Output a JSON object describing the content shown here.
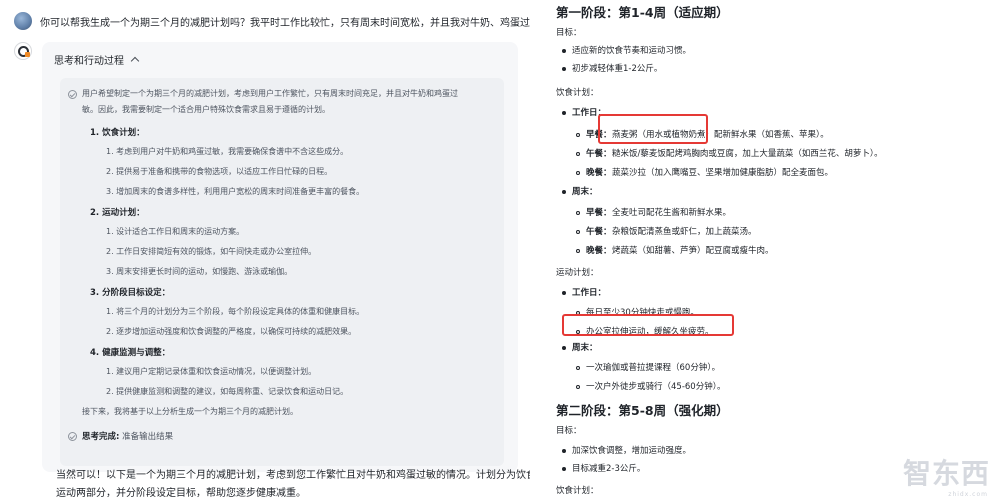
{
  "user_message": "你可以帮我生成一个为期三个月的减肥计划吗？我平时工作比较忙，只有周末时间宽松，并且我对牛奶、鸡蛋过敏。",
  "thinking": {
    "header": "思考和行动过程",
    "intro": [
      "用户希望制定一个为期三个月的减肥计划，考虑到用户工作繁忙，只有周末时间充足，并且对牛奶和鸡蛋过",
      "敏。因此，我需要制定一个适合用户特殊饮食需求且易于遵循的计划。"
    ],
    "sections": [
      {
        "title": "1.  饮食计划：",
        "items": [
          "1.  考虑到用户对牛奶和鸡蛋过敏，我需要确保食谱中不含这些成分。",
          "2.  提供易于准备和携带的食物选项，以适应工作日忙碌的日程。",
          "3.  增加周末的食谱多样性，利用用户宽松的周末时间准备更丰富的餐食。"
        ]
      },
      {
        "title": "2.  运动计划：",
        "items": [
          "1.  设计适合工作日和周末的运动方案。",
          "2.  工作日安排简短有效的锻炼，如午间快走或办公室拉伸。",
          "3.  周末安排更长时间的运动，如慢跑、游泳或瑜伽。"
        ]
      },
      {
        "title": "3.  分阶段目标设定：",
        "items": [
          "1.  将三个月的计划分为三个阶段，每个阶段设定具体的体重和健康目标。",
          "2.  逐步增加运动强度和饮食调整的严格度，以确保可持续的减肥效果。"
        ]
      },
      {
        "title": "4.  健康监测与调整：",
        "items": [
          "1.  建议用户定期记录体重和饮食运动情况，以便调整计划。",
          "2.  提供健康监测和调整的建议，如每周称重、记录饮食和运动日记。"
        ]
      }
    ],
    "outro": "接下来，我将基于以上分析生成一个为期三个月的减肥计划。",
    "done_bold": "思考完成:",
    "done_text": " 准备输出结果"
  },
  "answer": [
    "当然可以！以下是一个为期三个月的减肥计划，考虑到您工作繁忙且对牛奶和鸡蛋过敏的情况。计划分为饮食和",
    "运动两部分，并分阶段设定目标，帮助您逐步健康减重。"
  ],
  "plan": {
    "phase1_title": "第一阶段：第1-4周（适应期）",
    "goal_label": "目标：",
    "phase1_goals": [
      "适应新的饮食节奏和运动习惯。",
      "初步减轻体重1-2公斤。"
    ],
    "diet_label": "饮食计划：",
    "workday_label": "工作日：",
    "weekend_label": "周末：",
    "workday_meals": [
      {
        "label": "早餐：",
        "text": "燕麦粥（用水或植物奶煮）配新鲜水果（如香蕉、苹果）。"
      },
      {
        "label": "午餐：",
        "text": "糙米饭/藜麦饭配烤鸡胸肉或豆腐，加上大量蔬菜（如西兰花、胡萝卜）。"
      },
      {
        "label": "晚餐：",
        "text": "蔬菜沙拉（加入鹰嘴豆、坚果增加健康脂肪）配全麦面包。"
      }
    ],
    "weekend_meals": [
      {
        "label": "早餐：",
        "text": "全麦吐司配花生酱和新鲜水果。"
      },
      {
        "label": "午餐：",
        "text": "杂粮饭配清蒸鱼或虾仁，加上蔬菜汤。"
      },
      {
        "label": "晚餐：",
        "text": "烤蔬菜（如甜薯、芦笋）配豆腐或瘦牛肉。"
      }
    ],
    "exercise_label": "运动计划：",
    "workday_ex": [
      "每日至少30分钟快走或慢跑。",
      "办公室拉伸运动，缓解久坐疲劳。"
    ],
    "weekend_ex": [
      "一次瑜伽或普拉提课程（60分钟）。",
      "一次户外徒步或骑行（45-60分钟）。"
    ],
    "phase2_title": "第二阶段：第5-8周（强化期）",
    "phase2_goals": [
      "加深饮食调整，增加运动强度。",
      "目标减重2-3公斤。"
    ]
  },
  "watermark": {
    "main": "智东西",
    "sub": "zhidx.com"
  },
  "colors": {
    "highlight": "#e53935",
    "card_bg": "#f6f7f9"
  }
}
